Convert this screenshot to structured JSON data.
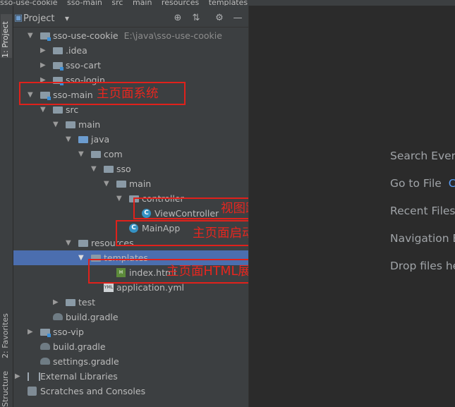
{
  "breadcrumb": [
    "sso-use-cookie",
    "sso-main",
    "src",
    "main",
    "resources",
    "templates"
  ],
  "side_tabs": {
    "project": "1: Project",
    "favorites": "2: Favorites",
    "structure": "Structure"
  },
  "panel": {
    "title": "Project",
    "dropdown": "▾",
    "icons": [
      "⊕",
      "⇅",
      "⚙",
      "—"
    ]
  },
  "tree": [
    {
      "label": "sso-use-cookie",
      "path": "E:\\java\\sso-use-cookie",
      "icon": "module-folder-icon",
      "expanded": true
    },
    {
      "label": ".idea",
      "icon": "folder-icon",
      "expanded": false
    },
    {
      "label": "sso-cart",
      "icon": "module-folder-icon",
      "expanded": false
    },
    {
      "label": "sso-login",
      "icon": "module-folder-icon",
      "expanded": false
    },
    {
      "label": "sso-main",
      "icon": "module-folder-icon",
      "expanded": true
    },
    {
      "label": "src",
      "icon": "folder-icon",
      "expanded": true
    },
    {
      "label": "main",
      "icon": "folder-icon",
      "expanded": true
    },
    {
      "label": "java",
      "icon": "source-folder-icon",
      "expanded": true
    },
    {
      "label": "com",
      "icon": "package-icon",
      "expanded": true
    },
    {
      "label": "sso",
      "icon": "package-icon",
      "expanded": true
    },
    {
      "label": "main",
      "icon": "package-icon",
      "expanded": true
    },
    {
      "label": "controller",
      "icon": "package-icon",
      "expanded": true
    },
    {
      "label": "ViewController",
      "icon": "class-icon"
    },
    {
      "label": "MainApp",
      "icon": "class-icon"
    },
    {
      "label": "resources",
      "icon": "resources-folder-icon",
      "expanded": true
    },
    {
      "label": "templates",
      "icon": "folder-icon",
      "expanded": true,
      "selected": true
    },
    {
      "label": "index.html",
      "icon": "html-file-icon"
    },
    {
      "label": "application.yml",
      "icon": "yml-file-icon"
    },
    {
      "label": "test",
      "icon": "folder-icon",
      "expanded": false
    },
    {
      "label": "build.gradle",
      "icon": "gradle-icon"
    },
    {
      "label": "sso-vip",
      "icon": "module-folder-icon",
      "expanded": false
    },
    {
      "label": "build.gradle",
      "icon": "gradle-icon"
    },
    {
      "label": "settings.gradle",
      "icon": "gradle-icon"
    },
    {
      "label": "External Libraries",
      "icon": "libraries-icon",
      "expanded": false
    },
    {
      "label": "Scratches and Consoles",
      "icon": "scratches-icon"
    }
  ],
  "annotations": [
    {
      "text": "主页面系统"
    },
    {
      "text": "视图跳转Controller"
    },
    {
      "text": "主页面启动"
    },
    {
      "text": "主页面HTML展示层"
    }
  ],
  "editor_hints": [
    {
      "text": "Search Every"
    },
    {
      "text": "Go to File",
      "key": "C"
    },
    {
      "text": "Recent Files"
    },
    {
      "text": "Navigation E"
    },
    {
      "text": "Drop files he"
    }
  ],
  "colors": {
    "annotation": "#e0211b",
    "selection": "#4b6eaf",
    "key_hint": "#589df6"
  }
}
